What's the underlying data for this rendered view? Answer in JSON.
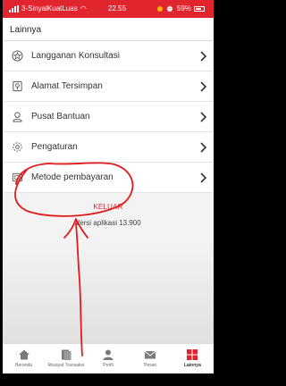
{
  "status_bar": {
    "carrier": "3-SinyalKuatLuas",
    "time": "22.55",
    "battery": "59%"
  },
  "header": {
    "title": "Lainnya"
  },
  "menu": {
    "items": [
      {
        "label": "Langganan Konsultasi",
        "icon": "star-badge-icon"
      },
      {
        "label": "Alamat Tersimpan",
        "icon": "map-pin-icon"
      },
      {
        "label": "Pusat Bantuan",
        "icon": "headset-icon"
      },
      {
        "label": "Pengaturan",
        "icon": "gear-icon"
      },
      {
        "label": "Metode pembayaran",
        "icon": "wallet-icon"
      }
    ]
  },
  "footer": {
    "logout_label": "KELUAR",
    "version_label": "Versi aplikasi 13.900"
  },
  "tabbar": {
    "tabs": [
      {
        "label": "Beranda",
        "icon": "home-icon",
        "active": false
      },
      {
        "label": "Riwayat Transaksi",
        "icon": "history-icon",
        "active": false
      },
      {
        "label": "Profil",
        "icon": "profile-icon",
        "active": false
      },
      {
        "label": "Pesan",
        "icon": "message-icon",
        "active": false
      },
      {
        "label": "Lainnya",
        "icon": "grid-icon",
        "active": true
      }
    ]
  },
  "colors": {
    "brand_red": "#e0252f",
    "annotation_red": "#e01b1b"
  }
}
